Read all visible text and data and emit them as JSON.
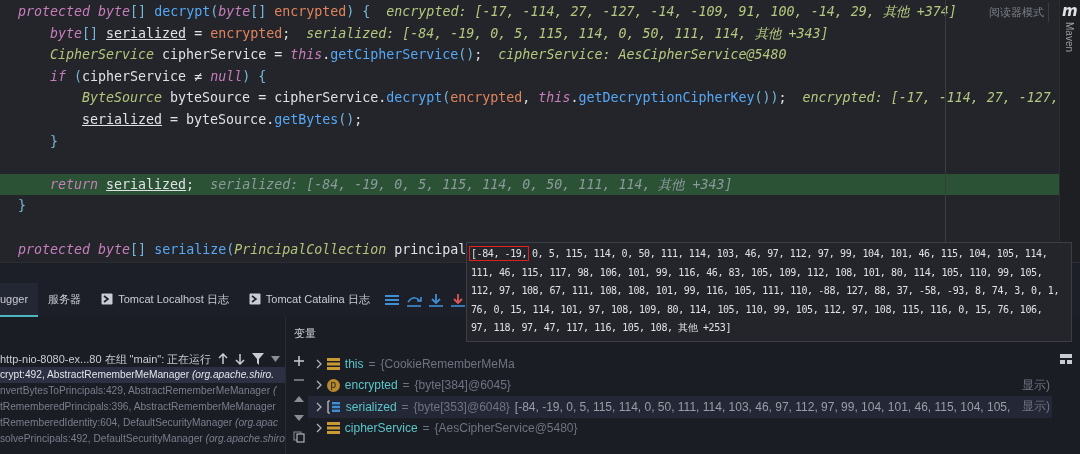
{
  "editor": {
    "reader_mode": "阅读器模式",
    "side_tool": {
      "logo": "m",
      "label": "Maven"
    },
    "lines": [
      {
        "highlighted": false,
        "tokens": [
          {
            "text": "protected ",
            "kind": "kw"
          },
          {
            "text": "byte",
            "kind": "kw"
          },
          {
            "text": "[] ",
            "kind": "punc"
          },
          {
            "text": "decrypt",
            "kind": "fn"
          },
          {
            "text": "(",
            "kind": "punc"
          },
          {
            "text": "byte",
            "kind": "kw"
          },
          {
            "text": "[] ",
            "kind": "punc"
          },
          {
            "text": "encrypted",
            "kind": "param"
          },
          {
            "text": ") {",
            "kind": "punc"
          }
        ],
        "hint": "encrypted: [-17, -114, 27, -127, -14, -109, 91, 100, -14, 29, 其他 +374]",
        "children": [
          {
            "highlighted": false,
            "tokens": [
              {
                "text": "byte",
                "kind": "kw"
              },
              {
                "text": "[] ",
                "kind": "punc"
              },
              {
                "text": "serialized",
                "kind": "local"
              },
              {
                "text": " = ",
                "kind": "plain"
              },
              {
                "text": "encrypted",
                "kind": "param"
              },
              {
                "text": ";",
                "kind": "plain"
              }
            ],
            "hint": "serialized: [-84, -19, 0, 5, 115, 114, 0, 50, 111, 114, 其他 +343]"
          },
          {
            "highlighted": false,
            "tokens": [
              {
                "text": "CipherService",
                "kind": "type"
              },
              {
                "text": " cipherService = ",
                "kind": "plain"
              },
              {
                "text": "this",
                "kind": "kw"
              },
              {
                "text": ".",
                "kind": "plain"
              },
              {
                "text": "getCipherService",
                "kind": "fn"
              },
              {
                "text": "()",
                "kind": "punc"
              },
              {
                "text": ";",
                "kind": "plain"
              }
            ],
            "hint": "cipherService: AesCipherService@5480"
          },
          {
            "highlighted": false,
            "tokens": [
              {
                "text": "if ",
                "kind": "kw"
              },
              {
                "text": "(",
                "kind": "punc"
              },
              {
                "text": "cipherService ≠ ",
                "kind": "plain"
              },
              {
                "text": "null",
                "kind": "kw"
              },
              {
                "text": ") {",
                "kind": "punc"
              }
            ],
            "children": [
              {
                "highlighted": false,
                "tokens": [
                  {
                    "text": "ByteSource",
                    "kind": "type"
                  },
                  {
                    "text": " byteSource = cipherService.",
                    "kind": "plain"
                  },
                  {
                    "text": "decrypt",
                    "kind": "fn"
                  },
                  {
                    "text": "(",
                    "kind": "punc"
                  },
                  {
                    "text": "encrypted",
                    "kind": "param"
                  },
                  {
                    "text": ", ",
                    "kind": "plain"
                  },
                  {
                    "text": "this",
                    "kind": "kw"
                  },
                  {
                    "text": ".",
                    "kind": "plain"
                  },
                  {
                    "text": "getDecryptionCipherKey",
                    "kind": "fn"
                  },
                  {
                    "text": "())",
                    "kind": "punc"
                  },
                  {
                    "text": ";",
                    "kind": "plain"
                  }
                ],
                "hint": "encrypted: [-17, -114, 27, -127,"
              },
              {
                "highlighted": false,
                "tokens": [
                  {
                    "text": "serialized",
                    "kind": "local"
                  },
                  {
                    "text": " = byteSource.",
                    "kind": "plain"
                  },
                  {
                    "text": "getBytes",
                    "kind": "fn"
                  },
                  {
                    "text": "()",
                    "kind": "punc"
                  },
                  {
                    "text": ";",
                    "kind": "plain"
                  }
                ]
              }
            ]
          },
          {
            "highlighted": false,
            "tokens": [
              {
                "text": "}",
                "kind": "punc"
              }
            ]
          },
          {
            "highlighted": false
          },
          {
            "highlighted": true,
            "tokens": [
              {
                "text": "return ",
                "kind": "kw"
              },
              {
                "text": "serialized",
                "kind": "local"
              },
              {
                "text": ";",
                "kind": "plain"
              }
            ],
            "hint": "serialized: [-84, -19, 0, 5, 115, 114, 0, 50, 111, 114, 其他 +343]"
          }
        ]
      },
      {
        "highlighted": false,
        "tokens": [
          {
            "text": "}",
            "kind": "punc"
          }
        ]
      },
      {
        "highlighted": false
      },
      {
        "highlighted": false,
        "tokens": [
          {
            "text": "protected ",
            "kind": "kw"
          },
          {
            "text": "byte",
            "kind": "kw"
          },
          {
            "text": "[] ",
            "kind": "punc"
          },
          {
            "text": "serialize",
            "kind": "fn"
          },
          {
            "text": "(",
            "kind": "punc"
          },
          {
            "text": "PrincipalCollection",
            "kind": "type"
          },
          {
            "text": " principal",
            "kind": "plain"
          }
        ]
      }
    ]
  },
  "debug": {
    "tabs": [
      {
        "label": "ugger",
        "kind": "plain",
        "selected": true
      },
      {
        "label": "服务器",
        "kind": "plain",
        "selected": false
      },
      {
        "label": "Tomcat Localhost 日志",
        "kind": "console",
        "selected": false
      },
      {
        "label": "Tomcat Catalina 日志",
        "kind": "console",
        "selected": false
      }
    ],
    "thread": "http-nio-8080-ex...80 在组 \"main\": 正在运行",
    "frames": [
      {
        "text": "crypt:492, AbstractRememberMeManager *(org.apache.shiro.*",
        "selected": true
      },
      {
        "text": "nvertBytesToPrincipals:429, AbstractRememberMeManager *(*",
        "selected": false
      },
      {
        "text": "tRememberedPrincipals:396, AbstractRememberMeManager",
        "selected": false
      },
      {
        "text": "tRememberedIdentity:604, DefaultSecurityManager *(org.apac*",
        "selected": false
      },
      {
        "text": "solvePrincipals:492, DefaultSecurityManager *(org.apache.shiro*",
        "selected": false
      }
    ],
    "variables_title": "变量",
    "variables": [
      {
        "kind": "object",
        "name": "this",
        "separator": "=",
        "value": "{CookieRememberMeMa",
        "selected": false
      },
      {
        "kind": "param",
        "badge": "p",
        "name": "encrypted",
        "separator": "=",
        "value": "{byte[384]@6045}",
        "trail": "显示)",
        "selected": false
      },
      {
        "kind": "array",
        "name": "serialized",
        "separator": "=",
        "value": "{byte[353]@6048}",
        "preview": "[-84, -19, 0, 5, 115, 114, 0, 50, 111, 114, 103, 46, 97, 112, 97, 99, 104, 101, 46, 115, 104, 105,",
        "trail": "显示)",
        "selected": true
      },
      {
        "kind": "object",
        "name": "cipherService",
        "separator": "=",
        "value": "{AesCipherService@5480}",
        "selected": false
      }
    ]
  },
  "tooltip": {
    "marked": "[-84, -19,",
    "lines": [
      "0, 5, 115, 114, 0, 50, 111, 114, 103, 46, 97, 112, 97, 99, 104, 101, 46, 115, 104, 105, 114,",
      "111, 46, 115, 117, 98, 106, 101, 99, 116, 46, 83, 105, 109, 112, 108, 101, 80, 114, 105, 110, 99, 105,",
      "112, 97, 108, 67, 111, 108, 108, 101, 99, 116, 105, 111, 110, -88, 127, 88, 37, -58, -93, 8, 74, 3, 0, 1,",
      "76, 0, 15, 114, 101, 97, 108, 109, 80, 114, 105, 110, 99, 105, 112, 97, 108, 115, 116, 0, 15, 76, 106,",
      "97, 118, 97, 47, 117, 116, 105, 108, 其他 +253]"
    ]
  }
}
